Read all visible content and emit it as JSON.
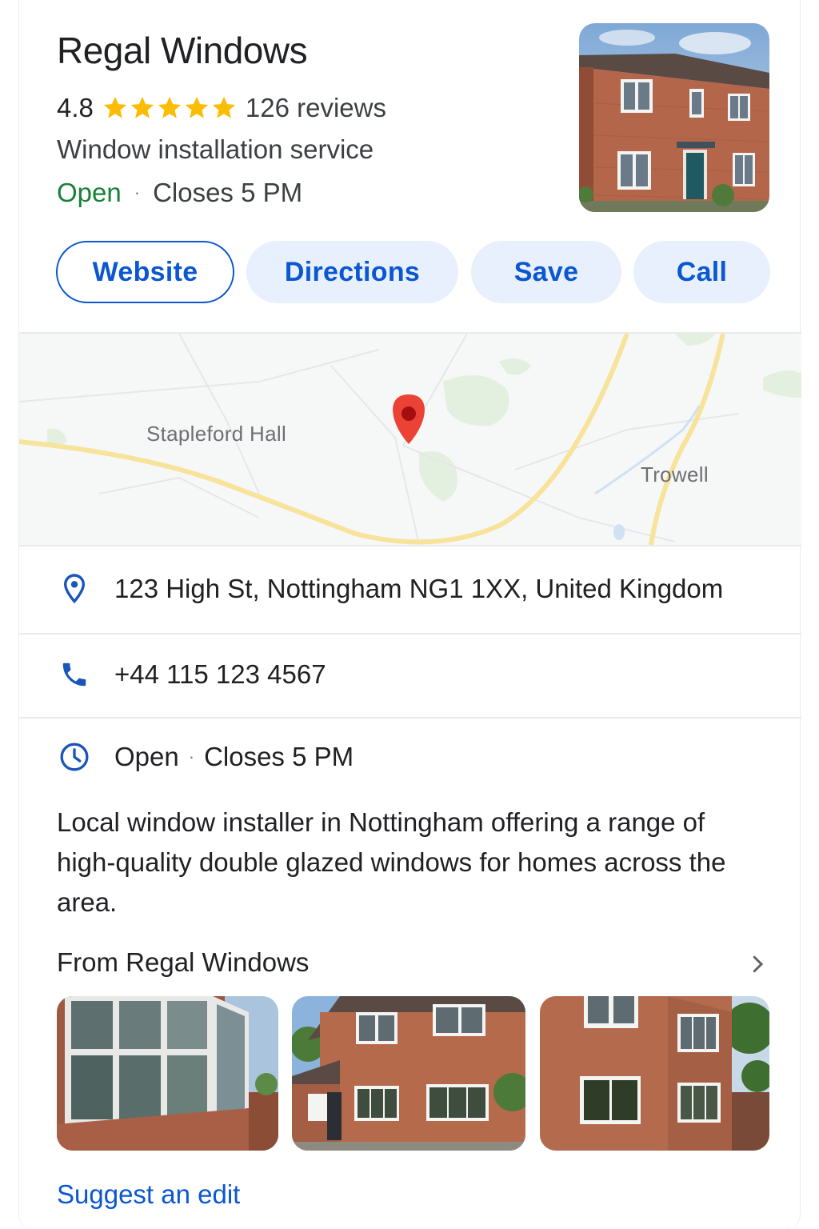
{
  "business": {
    "name": "Regal Windows",
    "rating": "4.8",
    "stars": 5,
    "reviews": "126 reviews",
    "category": "Window installation service",
    "status": "Open",
    "separator": "·",
    "closes": "Closes 5 PM"
  },
  "actions": {
    "website": "Website",
    "directions": "Directions",
    "save": "Save",
    "call": "Call"
  },
  "map": {
    "labels": {
      "left": "Stapleford Hall",
      "right": "Trowell"
    },
    "pin_color": "#ea4335"
  },
  "info": {
    "address": "123 High St, Nottingham NG1 1XX, United Kingdom",
    "phone": "+44 115 123 4567",
    "hours_status": "Open",
    "hours_separator": "·",
    "hours_closes": "Closes 5 PM"
  },
  "description": "Local window installer in Nottingham offering a range of high-quality double glazed windows for homes across the area.",
  "from_section": {
    "title": "From Regal Windows",
    "photos": [
      "window-closeup-photo",
      "house-front-photo",
      "house-side-photo"
    ]
  },
  "suggest_edit": "Suggest an edit",
  "colors": {
    "accent": "#0b57d0",
    "button_bg": "#e8f0fe",
    "open_green": "#188038",
    "star_yellow": "#fbbc04"
  },
  "icons": [
    "star-icon",
    "location-pin-icon",
    "phone-icon",
    "clock-icon",
    "chevron-right-icon",
    "map-pin-icon"
  ]
}
